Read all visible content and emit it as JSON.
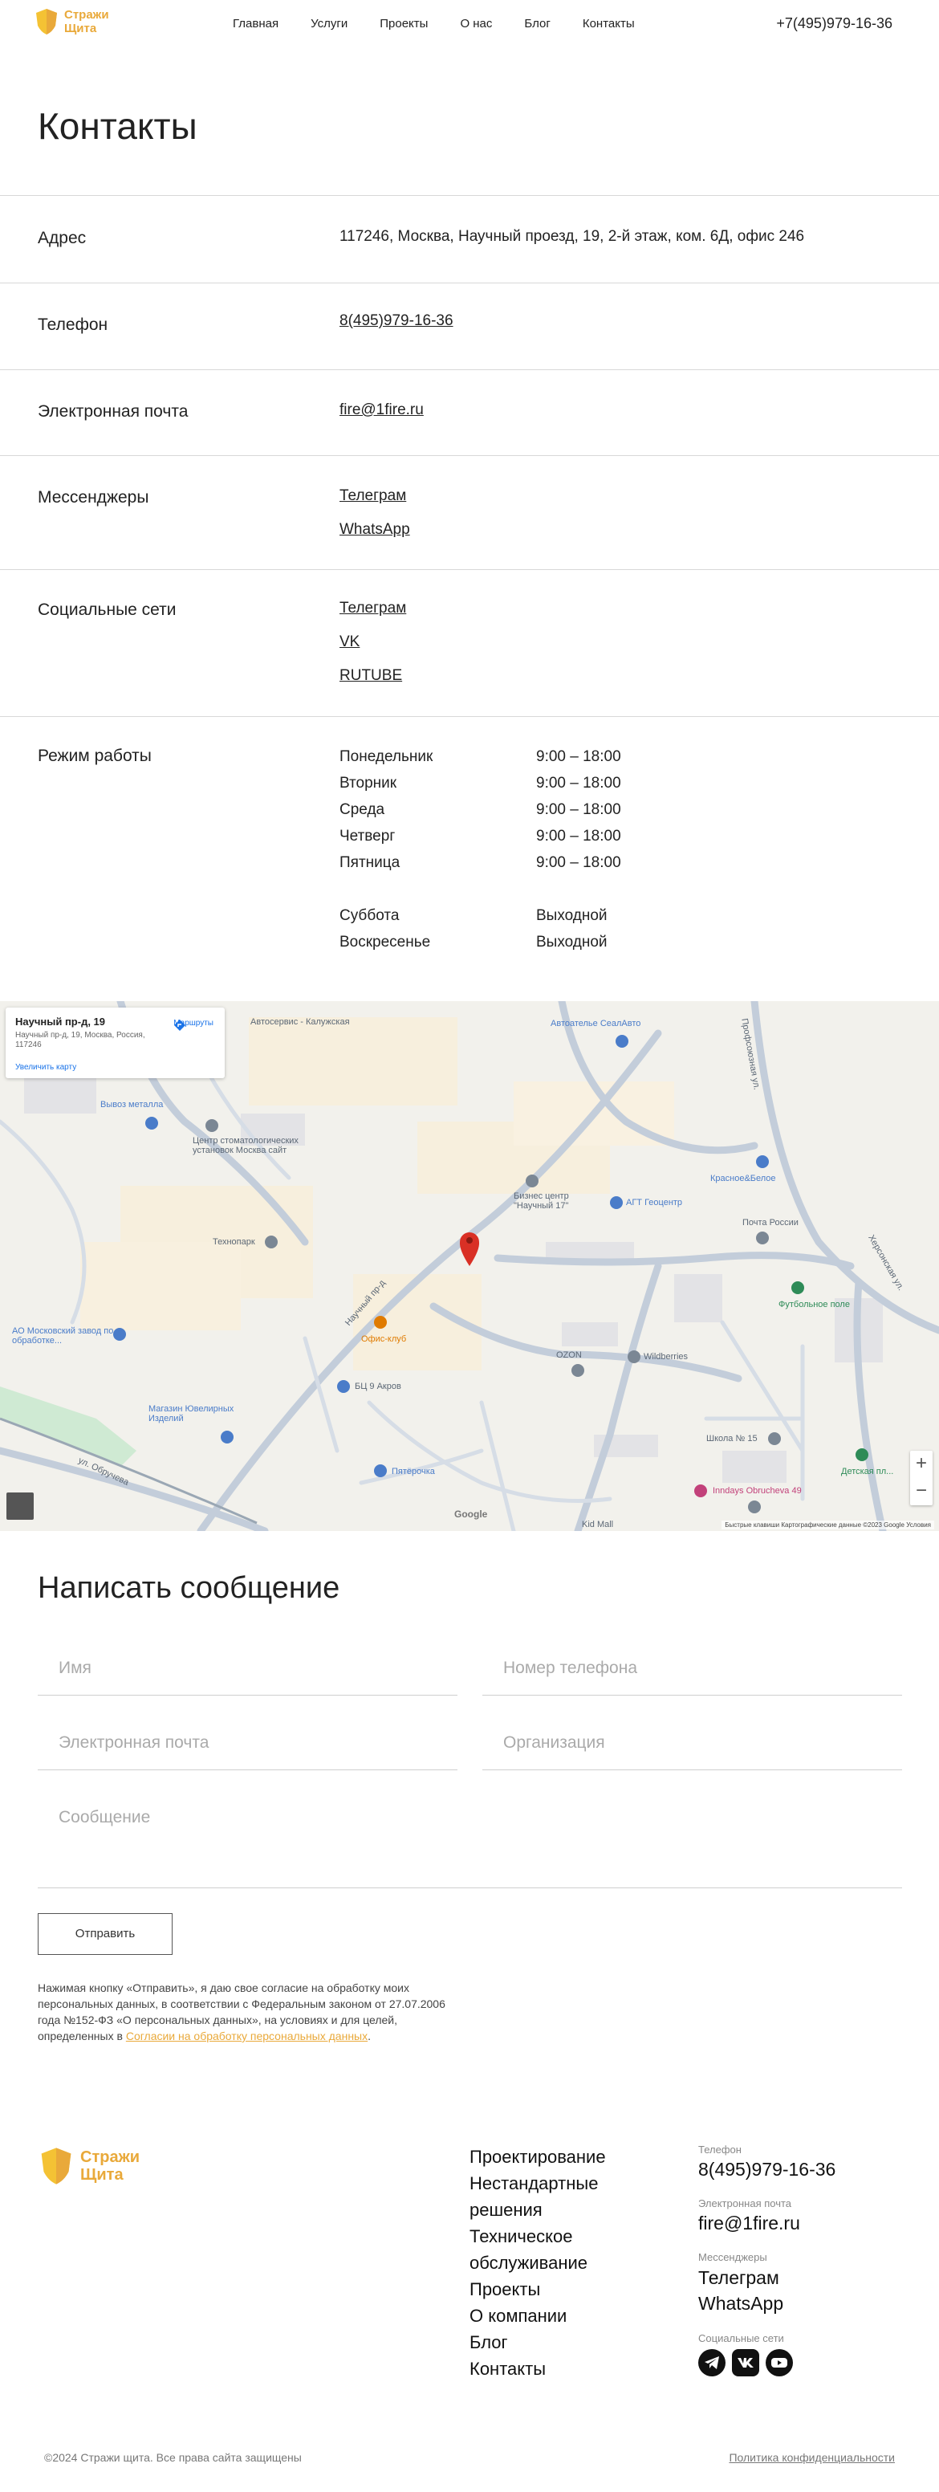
{
  "header": {
    "logo_line1": "Стражи",
    "logo_line2": "Щита",
    "nav": [
      "Главная",
      "Услуги",
      "Проекты",
      "О нас",
      "Блог",
      "Контакты"
    ],
    "phone": "+7(495)979-16-36"
  },
  "page_title": "Контакты",
  "contacts": {
    "address": {
      "label": "Адрес",
      "value": "117246, Москва, Научный проезд, 19, 2-й этаж, ком. 6Д, офис 246"
    },
    "phone": {
      "label": "Телефон",
      "value": "8(495)979-16-36"
    },
    "email": {
      "label": "Электронная почта",
      "value": "fire@1fire.ru"
    },
    "messengers": {
      "label": "Мессенджеры",
      "links": [
        "Телеграм",
        "WhatsApp"
      ]
    },
    "social": {
      "label": "Социальные сети",
      "links": [
        "Телеграм",
        "VK",
        "RUTUBE"
      ]
    },
    "hours": {
      "label": "Режим работы",
      "weekdays": [
        {
          "day": "Понедельник",
          "time": "9:00 – 18:00"
        },
        {
          "day": "Вторник",
          "time": "9:00 – 18:00"
        },
        {
          "day": "Среда",
          "time": "9:00 – 18:00"
        },
        {
          "day": "Четверг",
          "time": "9:00 – 18:00"
        },
        {
          "day": "Пятница",
          "time": "9:00 – 18:00"
        }
      ],
      "weekend": [
        {
          "day": "Суббота",
          "time": "Выходной"
        },
        {
          "day": "Воскресенье",
          "time": "Выходной"
        }
      ]
    }
  },
  "map": {
    "card_title": "Научный пр-д, 19",
    "card_address": "Научный пр-д, 19, Москва, Россия, 117246",
    "card_enlarge": "Увеличить карту",
    "card_route": "Маршруты",
    "labels": {
      "l1": "Автосервис - Калужская",
      "l2": "Автоателье СеалАвто",
      "l3": "Вывоз металла",
      "l4": "Центр стоматологических установок Москва сайт",
      "l5": "Технопарк",
      "l6": "Бизнес центр \"Научный 17\"",
      "l7": "АГТ Геоцентр",
      "l8": "Красное&Белое",
      "l9": "Почта России",
      "l10": "Футбольное поле",
      "l11": "АО Московский завод по обработке...",
      "l12": "Офис-клуб",
      "l13": "OZON",
      "l14": "Wildberries",
      "l15": "Магазин Ювелирных Изделий",
      "l16": "БЦ 9 Акров",
      "l17": "Школа № 15",
      "l18": "Детская пл...",
      "l19": "Пятёрочка",
      "l20": "Inndays Obrucheva 49",
      "l21": "Kid Mall",
      "l22": "ул. Обручева",
      "l23": "Научный пр-д",
      "l24": "Херсонская ул.",
      "l25": "Профсоюзная ул."
    },
    "google": "Google",
    "footer": "Быстрые клавиши   Картографические данные ©2023 Google   Условия"
  },
  "form": {
    "title": "Написать сообщение",
    "name_placeholder": "Имя",
    "phone_placeholder": "Номер телефона",
    "email_placeholder": "Электронная почта",
    "org_placeholder": "Организация",
    "message_placeholder": "Сообщение",
    "submit": "Отправить",
    "consent": "Нажимая кнопку «Отправить», я даю свое согласие на обработку моих персональных данных, в соответствии с Федеральным законом от 27.07.2006 года №152-ФЗ «О персональных данных», на условиях и для целей, определенных в ",
    "consent_link": "Согласии на обработку персональных данных",
    "consent_end": "."
  },
  "footer": {
    "nav": [
      "Проектирование",
      "Нестандартные решения",
      "Техническое обслуживание",
      "Проекты",
      "О компании",
      "Блог",
      "Контакты"
    ],
    "phone_label": "Телефон",
    "phone": "8(495)979-16-36",
    "email_label": "Электронная почта",
    "email": "fire@1fire.ru",
    "messengers_label": "Мессенджеры",
    "messengers": [
      "Телеграм",
      "WhatsApp"
    ],
    "social_label": "Социальные сети",
    "copyright": "©2024 Стражи щита. Все права сайта защищены",
    "policy": "Политика конфиденциальности"
  },
  "colors": {
    "accent": "#e9a93a",
    "text": "#222222",
    "divider": "#d8d8d8"
  }
}
